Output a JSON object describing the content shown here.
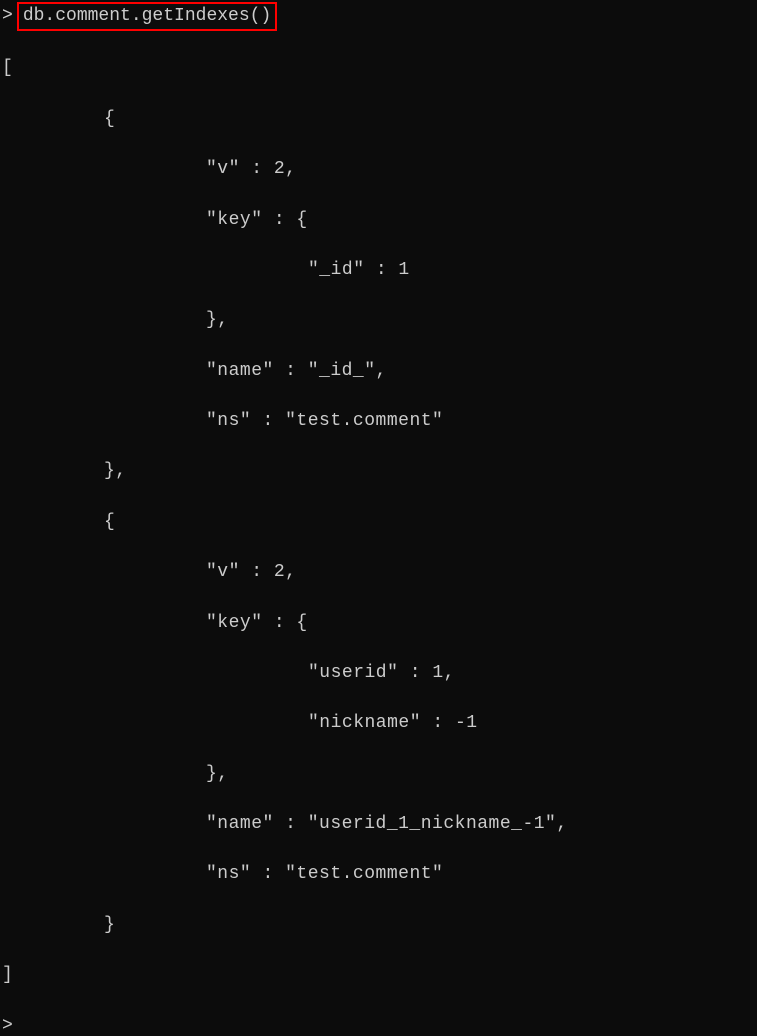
{
  "prompt": ">",
  "command": "db.comment.getIndexes()",
  "result": {
    "open_bracket": "[",
    "close_bracket": "]",
    "indexes": [
      {
        "open": "{",
        "v_key": "\"v\"",
        "v_val": "2",
        "key_key": "\"key\"",
        "key_open": "{",
        "key_fields": [
          {
            "name": "\"_id\"",
            "val": "1"
          }
        ],
        "key_close": "},",
        "name_key": "\"name\"",
        "name_val": "\"_id_\"",
        "ns_key": "\"ns\"",
        "ns_val": "\"test.comment\"",
        "close": "},"
      },
      {
        "open": "{",
        "v_key": "\"v\"",
        "v_val": "2",
        "key_key": "\"key\"",
        "key_open": "{",
        "key_fields": [
          {
            "name": "\"userid\"",
            "val": "1"
          },
          {
            "name": "\"nickname\"",
            "val": "-1"
          }
        ],
        "key_close": "},",
        "name_key": "\"name\"",
        "name_val": "\"userid_1_nickname_-1\"",
        "ns_key": "\"ns\"",
        "ns_val": "\"test.comment\"",
        "close": "}"
      }
    ]
  },
  "final_prompt": ">"
}
